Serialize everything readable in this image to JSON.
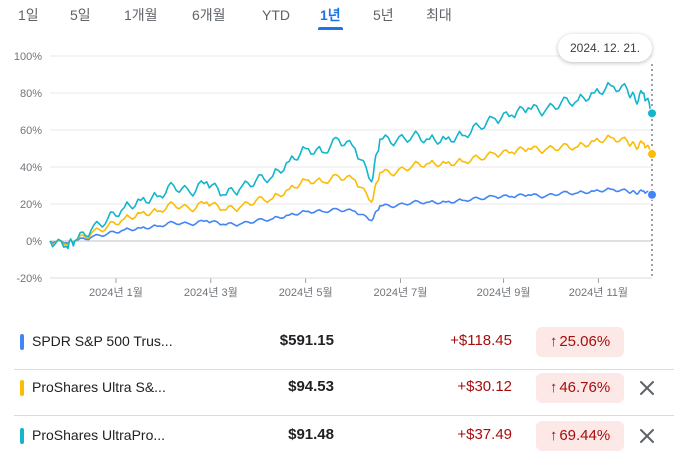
{
  "range_tabs": [
    {
      "label": "1일",
      "active": false
    },
    {
      "label": "5일",
      "active": false
    },
    {
      "label": "1개월",
      "active": false
    },
    {
      "label": "6개월",
      "active": false
    },
    {
      "label": "YTD",
      "active": false
    },
    {
      "label": "1년",
      "active": true
    },
    {
      "label": "5년",
      "active": false
    },
    {
      "label": "최대",
      "active": false
    }
  ],
  "tooltip_date": "2024. 12. 21.",
  "chart_data": {
    "type": "line",
    "title": "",
    "xlabel": "",
    "ylabel": "",
    "x_ticks": [
      "2024년 1월",
      "2024년 3월",
      "2024년 5월",
      "2024년 7월",
      "2024년 9월",
      "2024년 11월"
    ],
    "y_ticks": [
      "100%",
      "80%",
      "60%",
      "40%",
      "20%",
      "0%",
      "-20%"
    ],
    "ylim": [
      -20,
      100
    ],
    "grid": "horizontal",
    "series": [
      {
        "name": "SPDR S&P 500 Trus...",
        "color": "#4285f4",
        "points": [
          [
            0,
            0
          ],
          [
            2,
            -1
          ],
          [
            3,
            0
          ],
          [
            5,
            2
          ],
          [
            7,
            4
          ],
          [
            9,
            6
          ],
          [
            11,
            7
          ],
          [
            13,
            8
          ],
          [
            15,
            10
          ],
          [
            17,
            9
          ],
          [
            19,
            11
          ],
          [
            21,
            9
          ],
          [
            23,
            9
          ],
          [
            25,
            11
          ],
          [
            27,
            12
          ],
          [
            29,
            14
          ],
          [
            31,
            16
          ],
          [
            33,
            16
          ],
          [
            35,
            17
          ],
          [
            37,
            16
          ],
          [
            39,
            11
          ],
          [
            40,
            19
          ],
          [
            42,
            19
          ],
          [
            44,
            21
          ],
          [
            46,
            21
          ],
          [
            48,
            21
          ],
          [
            50,
            22
          ],
          [
            52,
            23
          ],
          [
            54,
            24
          ],
          [
            56,
            24
          ],
          [
            58,
            25
          ],
          [
            60,
            24
          ],
          [
            62,
            26
          ],
          [
            64,
            26
          ],
          [
            66,
            27
          ],
          [
            68,
            28
          ],
          [
            70,
            27
          ],
          [
            71,
            26
          ],
          [
            72,
            27
          ],
          [
            73,
            25
          ]
        ]
      },
      {
        "name": "ProShares Ultra S&...",
        "color": "#fbbc04",
        "points": [
          [
            0,
            0
          ],
          [
            2,
            -2
          ],
          [
            3,
            0
          ],
          [
            5,
            4
          ],
          [
            7,
            8
          ],
          [
            9,
            12
          ],
          [
            11,
            15
          ],
          [
            13,
            16
          ],
          [
            15,
            20
          ],
          [
            17,
            17
          ],
          [
            19,
            21
          ],
          [
            21,
            17
          ],
          [
            23,
            18
          ],
          [
            25,
            22
          ],
          [
            27,
            23
          ],
          [
            29,
            28
          ],
          [
            31,
            33
          ],
          [
            33,
            32
          ],
          [
            35,
            35
          ],
          [
            37,
            33
          ],
          [
            39,
            21
          ],
          [
            40,
            37
          ],
          [
            42,
            37
          ],
          [
            44,
            41
          ],
          [
            46,
            42
          ],
          [
            48,
            42
          ],
          [
            50,
            43
          ],
          [
            52,
            45
          ],
          [
            54,
            47
          ],
          [
            56,
            48
          ],
          [
            58,
            50
          ],
          [
            60,
            49
          ],
          [
            62,
            51
          ],
          [
            64,
            51
          ],
          [
            66,
            54
          ],
          [
            68,
            56
          ],
          [
            70,
            54
          ],
          [
            71,
            51
          ],
          [
            72,
            53
          ],
          [
            73,
            47
          ]
        ]
      },
      {
        "name": "ProShares UltraPro...",
        "color": "#12b5cb",
        "points": [
          [
            0,
            0
          ],
          [
            2,
            -3
          ],
          [
            3,
            0
          ],
          [
            5,
            6
          ],
          [
            7,
            12
          ],
          [
            9,
            18
          ],
          [
            11,
            22
          ],
          [
            13,
            24
          ],
          [
            15,
            30
          ],
          [
            17,
            26
          ],
          [
            19,
            32
          ],
          [
            21,
            25
          ],
          [
            23,
            28
          ],
          [
            25,
            33
          ],
          [
            27,
            35
          ],
          [
            29,
            43
          ],
          [
            31,
            50
          ],
          [
            33,
            48
          ],
          [
            35,
            55
          ],
          [
            37,
            50
          ],
          [
            39,
            32
          ],
          [
            40,
            55
          ],
          [
            42,
            54
          ],
          [
            44,
            57
          ],
          [
            46,
            55
          ],
          [
            48,
            55
          ],
          [
            50,
            57
          ],
          [
            52,
            62
          ],
          [
            54,
            66
          ],
          [
            56,
            68
          ],
          [
            58,
            72
          ],
          [
            60,
            70
          ],
          [
            62,
            75
          ],
          [
            64,
            76
          ],
          [
            66,
            80
          ],
          [
            68,
            84
          ],
          [
            70,
            82
          ],
          [
            71,
            76
          ],
          [
            72,
            80
          ],
          [
            73,
            69
          ]
        ]
      }
    ]
  },
  "rows": [
    {
      "name": "SPDR S&P 500 Trus...",
      "color": "#4285f4",
      "price": "$591.15",
      "change": "+$118.45",
      "pct": "25.06%",
      "removable": false
    },
    {
      "name": "ProShares Ultra S&...",
      "color": "#fbbc04",
      "price": "$94.53",
      "change": "+$30.12",
      "pct": "46.76%",
      "removable": true
    },
    {
      "name": "ProShares UltraPro...",
      "color": "#12b5cb",
      "price": "$91.48",
      "change": "+$37.49",
      "pct": "69.44%",
      "removable": true
    }
  ]
}
